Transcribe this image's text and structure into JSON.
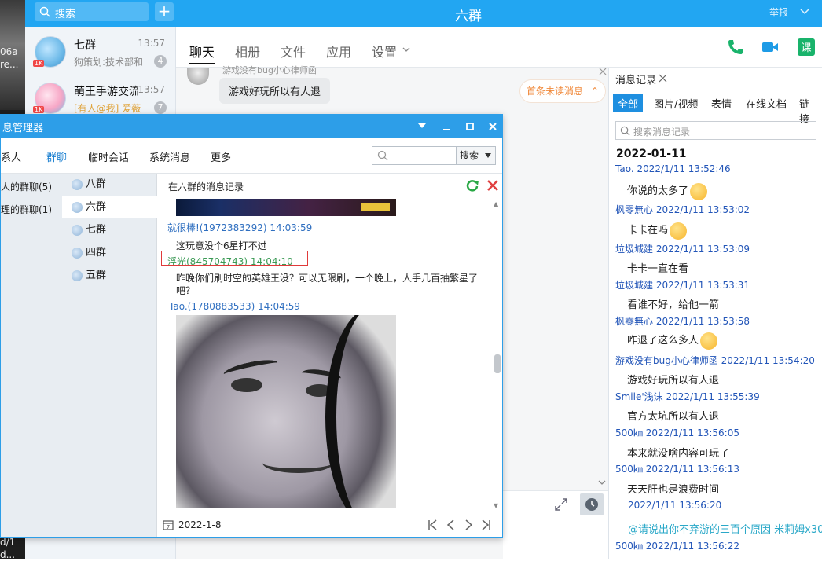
{
  "desktop": {
    "lines": [
      "06a",
      "re...",
      "d/1",
      "d..."
    ]
  },
  "sidebar": {
    "search_placeholder": "搜索",
    "add_label": "+",
    "contacts": [
      {
        "name": "七群",
        "time": "13:57",
        "preview": "狗策划:技术部和",
        "badge": "4",
        "level": "1K"
      },
      {
        "name": "萌王手游交流",
        "time": "13:57",
        "preview": "[有人@我] 爱薇",
        "badge": "7",
        "level": "1K"
      }
    ]
  },
  "header": {
    "title": "六群",
    "report": "举报"
  },
  "tabs": [
    {
      "label": "聊天"
    },
    {
      "label": "相册"
    },
    {
      "label": "文件"
    },
    {
      "label": "应用"
    },
    {
      "label": "设置"
    }
  ],
  "chat": {
    "sender_name": "游戏没有bug小心律师函",
    "bubble_text": "游戏好玩所以有人退",
    "unread_label": "首条未读消息"
  },
  "history": {
    "title": "消息记录",
    "filters": [
      {
        "label": "全部"
      },
      {
        "label": "图片/视频"
      },
      {
        "label": "表情"
      },
      {
        "label": "在线文档"
      },
      {
        "label": "链接"
      }
    ],
    "search_placeholder": "搜索消息记录",
    "date": "2022-01-11",
    "entries": [
      {
        "sender": "Tao. 2022/1/11 13:52:46",
        "text": "你说的太多了"
      },
      {
        "sender": "枫零無心 2022/1/11 13:53:02",
        "text": "卡卡在吗"
      },
      {
        "sender": "垃圾城建 2022/1/11 13:53:09",
        "text": "卡卡一直在看"
      },
      {
        "sender": "垃圾城建 2022/1/11 13:53:31",
        "text": "看谁不好，给他一箭"
      },
      {
        "sender": "枫零無心 2022/1/11 13:53:58",
        "text": "咋退了这么多人"
      },
      {
        "sender": "游戏没有bug小心律师函 2022/1/11 13:54:20",
        "text": "游戏好玩所以有人退"
      },
      {
        "sender": "Smile'浅沫 2022/1/11 13:55:39",
        "text": "官方太坑所以有人退"
      },
      {
        "sender": "500㎞ 2022/1/11 13:56:05",
        "text": "本来就没啥内容可玩了"
      },
      {
        "sender": "500㎞ 2022/1/11 13:56:13",
        "text": "天天肝也是浪费时间"
      },
      {
        "sender": "2022/1/11 13:56:20",
        "text": "@请说出你不弃游的三百个原因 米莉姆x30"
      },
      {
        "sender": "500㎞ 2022/1/11 13:56:22",
        "text": ""
      }
    ]
  },
  "manager": {
    "title": "息管理器",
    "nav": [
      {
        "label": "系人"
      },
      {
        "label": "群聊"
      },
      {
        "label": "临时会话"
      },
      {
        "label": "系统消息"
      },
      {
        "label": "更多"
      }
    ],
    "search_button": "搜索",
    "tree": [
      {
        "label": "人的群聊(5)"
      },
      {
        "label": "理的群聊(1)"
      }
    ],
    "groups": [
      {
        "label": "八群"
      },
      {
        "label": "六群"
      },
      {
        "label": "七群"
      },
      {
        "label": "四群"
      },
      {
        "label": "五群"
      }
    ],
    "content_title": "在六群的消息记录",
    "messages": [
      {
        "sender": "就很棒!(1972383292) 14:03:59",
        "text": "这玩意没个6星打不过"
      },
      {
        "sender": "浮光(845704743) 14:04:10",
        "text": "昨晚你们刷时空的英雄王没？可以无限刷，一个晚上，人手几百抽繁星了吧？"
      },
      {
        "sender": "Tao.(1780883533) 14:04:59",
        "text": ""
      }
    ],
    "footer_date": "2022-1-8"
  }
}
